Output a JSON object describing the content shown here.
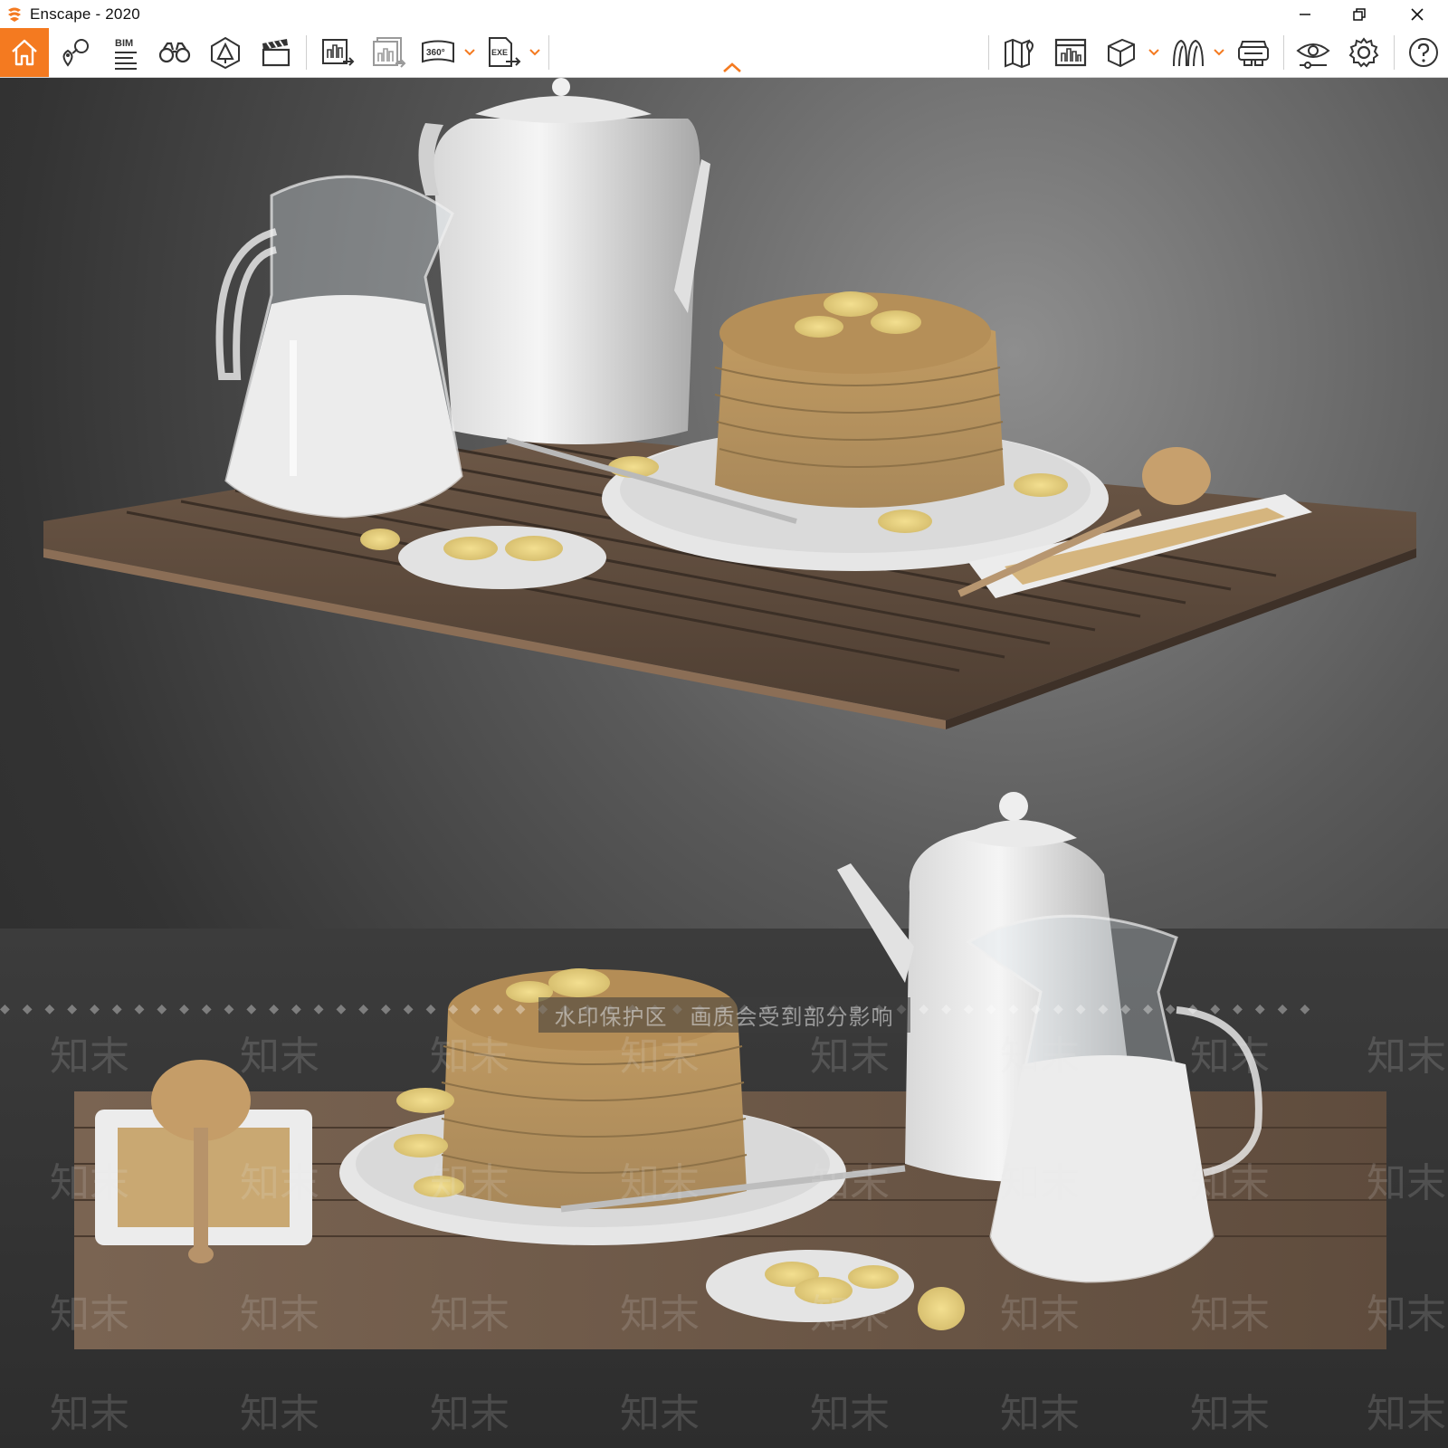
{
  "window": {
    "title": "Enscape - 2020",
    "controls": [
      "minimize",
      "restore",
      "close"
    ]
  },
  "theme": {
    "accent": "#f47a20",
    "toolbar_bg": "#ffffff",
    "icon_color": "#333333"
  },
  "toolbar": {
    "left": [
      {
        "id": "home",
        "icon": "home-icon",
        "active": true
      },
      {
        "id": "views",
        "icon": "location-icon"
      },
      {
        "id": "bim",
        "icon": "bim-icon",
        "label": "BIM"
      },
      {
        "id": "walk",
        "icon": "binoculars-icon"
      },
      {
        "id": "assets",
        "icon": "asset-library-icon"
      },
      {
        "id": "video",
        "icon": "clapperboard-icon"
      },
      {
        "id": "export-image",
        "icon": "export-image-icon"
      },
      {
        "id": "batch-render",
        "icon": "batch-render-icon"
      },
      {
        "id": "export-360",
        "icon": "panorama-360-icon",
        "label": "360°",
        "has_dropdown": true
      },
      {
        "id": "export-exe",
        "icon": "export-exe-icon",
        "label": "EXE",
        "has_dropdown": true
      }
    ],
    "right": [
      {
        "id": "map",
        "icon": "map-icon"
      },
      {
        "id": "render-settings",
        "icon": "render-window-icon"
      },
      {
        "id": "cube",
        "icon": "cube-icon",
        "has_dropdown": true
      },
      {
        "id": "people",
        "icon": "people-icon",
        "has_dropdown": true
      },
      {
        "id": "vr",
        "icon": "vr-headset-icon"
      },
      {
        "id": "visual-settings",
        "icon": "eye-settings-icon"
      },
      {
        "id": "settings",
        "icon": "gear-icon"
      },
      {
        "id": "help",
        "icon": "help-icon"
      }
    ],
    "collapse_icon": "chevron-up-icon"
  },
  "viewport": {
    "watermark_notice": "水印保护区　画质会受到部分影响",
    "watermark_tile": "知末",
    "watermark_small": "知末"
  }
}
